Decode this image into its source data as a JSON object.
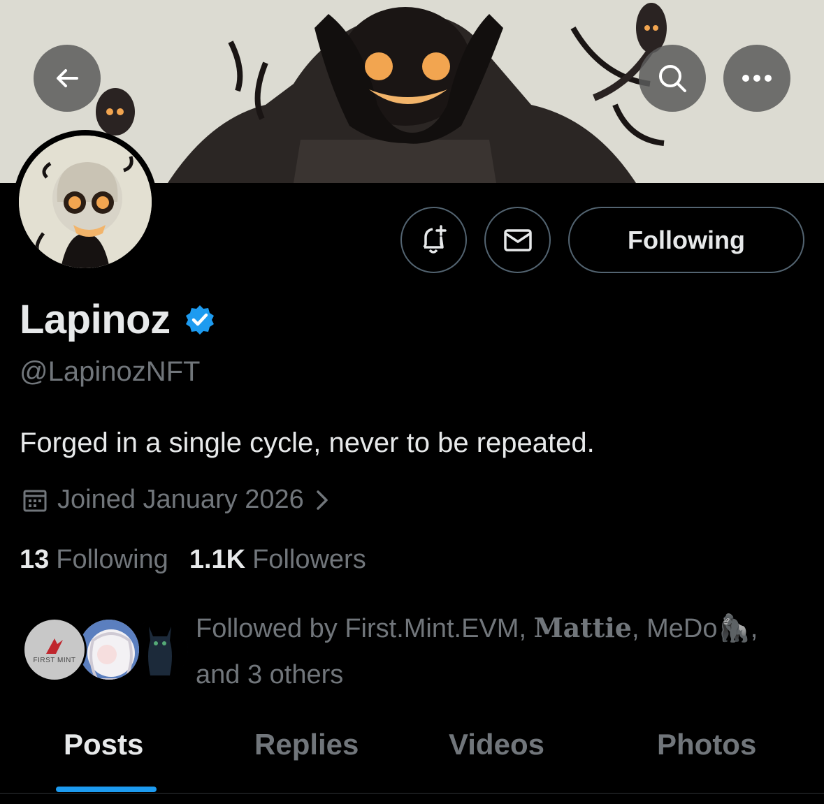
{
  "profile": {
    "name": "Lapinoz",
    "handle": "@LapinozNFT",
    "bio": "Forged in a single cycle, never to be repeated.",
    "joined": "Joined January 2026",
    "verified": true
  },
  "header": {
    "back_icon": "arrow-left-icon",
    "search_icon": "search-icon",
    "more_icon": "more-horizontal-icon"
  },
  "actions": {
    "notify_icon": "bell-plus-icon",
    "message_icon": "envelope-icon",
    "following_label": "Following"
  },
  "stats": {
    "following_count": "13",
    "following_label": "Following",
    "followers_count": "1.1K",
    "followers_label": "Followers"
  },
  "followed_by": {
    "prefix": "Followed by First.Mint.EVM,",
    "name2": "Mattie",
    "name3": "MeDo🦍,",
    "suffix": "and 3 others",
    "avatar1_text": "FIRST MINT"
  },
  "tabs": [
    {
      "label": "Posts",
      "active": true
    },
    {
      "label": "Replies",
      "active": false
    },
    {
      "label": "Videos",
      "active": false
    },
    {
      "label": "Photos",
      "active": false
    }
  ],
  "colors": {
    "background": "#000000",
    "accent": "#1d9bf0",
    "muted": "#71767b",
    "text": "#e7e9ea",
    "verified": "#1d9bf0"
  }
}
